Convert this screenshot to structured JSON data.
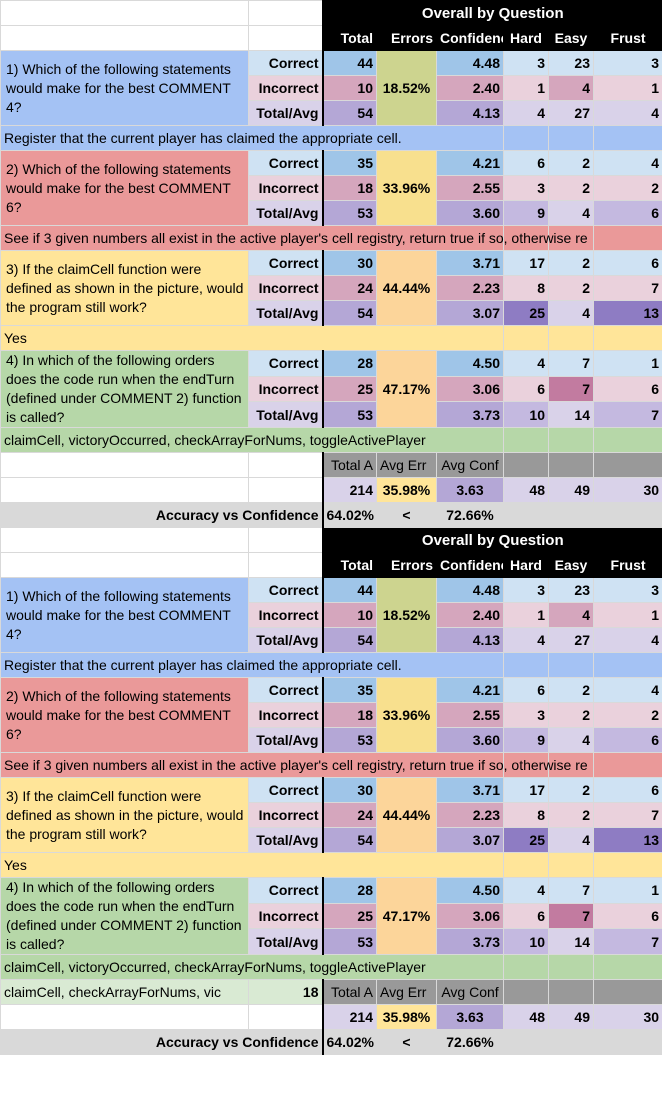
{
  "header": {
    "title": "Overall by Question",
    "columns": [
      "Total",
      "Errors",
      "Confidence",
      "Hard",
      "Easy",
      "Frust"
    ]
  },
  "row_labels": {
    "correct": "Correct",
    "incorrect": "Incorrect",
    "total": "Total/Avg"
  },
  "questions": [
    {
      "text": "1) Which of the following statements would make for the best COMMENT 4?",
      "answer": "Register that the current player has claimed the appropriate cell.",
      "errors": "18.52%",
      "correct": {
        "total": "44",
        "confidence": "4.48",
        "hard": "3",
        "easy": "23",
        "frust": "3"
      },
      "incorrect": {
        "total": "10",
        "confidence": "2.40",
        "hard": "1",
        "easy": "4",
        "frust": "1"
      },
      "totalavg": {
        "total": "54",
        "confidence": "4.13",
        "hard": "4",
        "easy": "27",
        "frust": "4"
      }
    },
    {
      "text": "2) Which of the following statements would make for the best COMMENT 6?",
      "answer": "See if 3 given numbers all exist in the active player's cell registry, return true if so, otherwise re",
      "errors": "33.96%",
      "correct": {
        "total": "35",
        "confidence": "4.21",
        "hard": "6",
        "easy": "2",
        "frust": "4"
      },
      "incorrect": {
        "total": "18",
        "confidence": "2.55",
        "hard": "3",
        "easy": "2",
        "frust": "2"
      },
      "totalavg": {
        "total": "53",
        "confidence": "3.60",
        "hard": "9",
        "easy": "4",
        "frust": "6"
      }
    },
    {
      "text": "3) If the claimCell function were defined as shown in the picture, would the program still work?",
      "answer": "Yes",
      "errors": "44.44%",
      "correct": {
        "total": "30",
        "confidence": "3.71",
        "hard": "17",
        "easy": "2",
        "frust": "6"
      },
      "incorrect": {
        "total": "24",
        "confidence": "2.23",
        "hard": "8",
        "easy": "2",
        "frust": "7"
      },
      "totalavg": {
        "total": "54",
        "confidence": "3.07",
        "hard": "25",
        "easy": "4",
        "frust": "13"
      }
    },
    {
      "text": "4) In which of the following orders does the code run when the endTurn (defined under COMMENT 2) function is called?",
      "answer": "claimCell, victoryOccurred, checkArrayForNums, toggleActivePlayer",
      "errors": "47.17%",
      "correct": {
        "total": "28",
        "confidence": "4.50",
        "hard": "4",
        "easy": "7",
        "frust": "1"
      },
      "incorrect": {
        "total": "25",
        "confidence": "3.06",
        "hard": "6",
        "easy": "7",
        "frust": "6"
      },
      "totalavg": {
        "total": "53",
        "confidence": "3.73",
        "hard": "10",
        "easy": "14",
        "frust": "7"
      }
    }
  ],
  "extra_answer": {
    "text": "claimCell, checkArrayForNums, vic",
    "count": "18"
  },
  "summary": {
    "headers": [
      "Total A",
      "Avg Err",
      "Avg Conf"
    ],
    "total": "214",
    "avg_err": "35.98%",
    "avg_conf": "3.63",
    "hard": "48",
    "easy": "49",
    "frust": "30",
    "accuracy_label": "Accuracy vs Confidence",
    "accuracy": "64.02%",
    "comparator": "<",
    "confidence_pct": "72.66%"
  }
}
